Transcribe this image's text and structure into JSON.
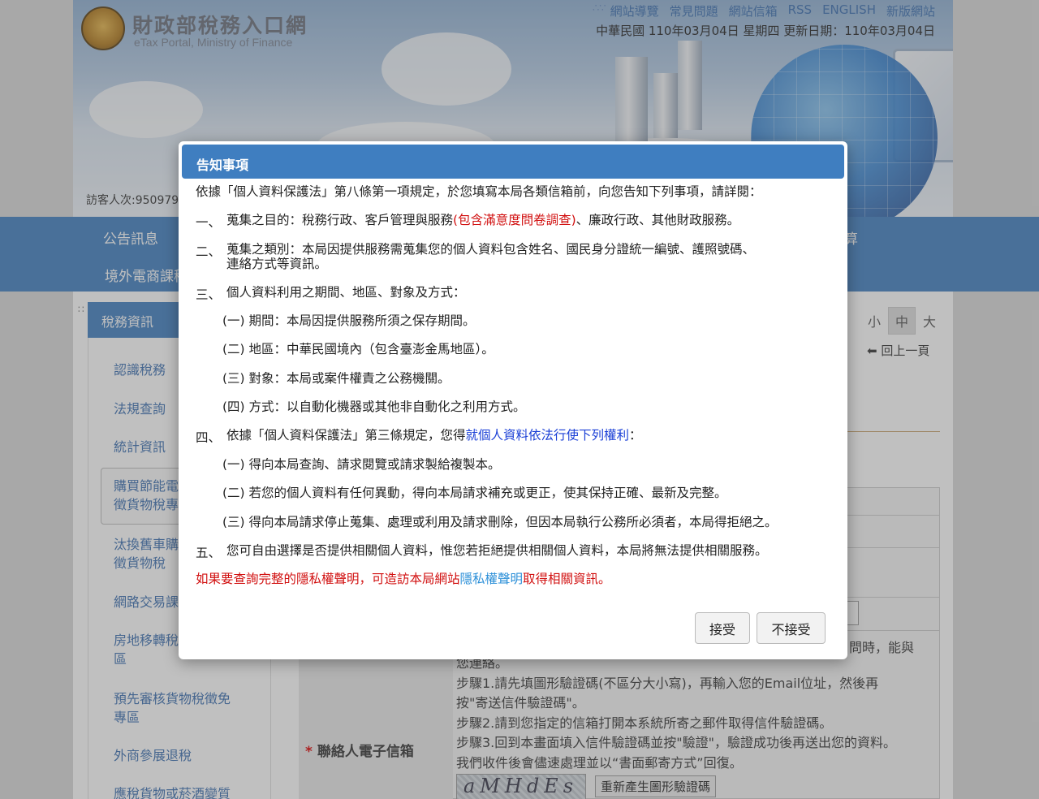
{
  "site": {
    "title": "財政部稅務入口網",
    "subtitle": "eTax Portal, Ministry of Finance",
    "top_links": [
      "網站導覽",
      "常見問題",
      "網站信箱",
      "RSS",
      "ENGLISH",
      "新版網站"
    ],
    "date_line": "中華民國 110年03月04日 星期四 更新日期：110年03月04日",
    "visitor": "訪客人次:950979"
  },
  "nav": {
    "item1": "公告訊息",
    "item2": "境外電商課稅",
    "item_right": "算"
  },
  "sidebar": {
    "heading": "稅務資訊",
    "items": [
      {
        "label": "認識稅務"
      },
      {
        "label": "法規查詢"
      },
      {
        "label": "統計資訊"
      },
      {
        "label_line1": "購買節能電",
        "label_line2": "徵貨物稅專"
      },
      {
        "label_line1": "汰換舊車購",
        "label_line2": "徵貨物稅"
      },
      {
        "label": "網路交易課"
      },
      {
        "label_line1": "房地移轉稅",
        "label_line2": "區"
      },
      {
        "label_line1": "預先審核貨物稅徵免",
        "label_line2": "專區"
      },
      {
        "label": "外商參展退稅"
      },
      {
        "label": "應稅貨物或菸酒變質"
      }
    ]
  },
  "toolbar": {
    "font_small": "小",
    "font_mid": "中",
    "font_large": "大",
    "back": "回上一頁"
  },
  "form": {
    "email_label": "聯絡人電子信箱",
    "required_mark": "*",
    "note_tail": "問時，能與",
    "note_line0": "您連絡。",
    "step1a": "步驟1.請先填圖形驗證碼(不區分大小寫)，再輸入您的Email位址，然後再",
    "step1b": "按\"寄送信件驗證碼\"。",
    "step2": "步驟2.請到您指定的信箱打開本系統所寄之郵件取得信件驗證碼。",
    "step3": "步驟3.回到本畫面填入信件驗證碼並按\"驗證\"，驗證成功後再送出您的資料。",
    "step4": "我們收件後會儘速處理並以“書面郵寄方式”回復。",
    "captcha_text": "aMHdEs",
    "regen_button": "重新產生圖形驗證碼"
  },
  "modal": {
    "title": "告知事項",
    "intro": "依據「個人資料保護法」第八條第一項規定，於您填寫本局各類信箱前，向您告知下列事項，請詳閱：",
    "s1_num": "一、",
    "s1_a": "蒐集之目的：稅務行政、客戶管理與服務",
    "s1_red": "(包含滿意度問卷調查)",
    "s1_b": "、廉政行政、其他財政服務。",
    "s2_num": "二、",
    "s2_a": "蒐集之類別：本局因提供服務需蒐集您的個人資料包含姓名、國民身分證統一編號、護照號碼、",
    "s2_b": "連絡方式等資訊。",
    "s3_num": "三、",
    "s3": "個人資料利用之期間、地區、對象及方式：",
    "s3_1": "(一) 期間：本局因提供服務所須之保存期間。",
    "s3_2": "(二) 地區：中華民國境內（包含臺澎金馬地區）。",
    "s3_3": "(三) 對象：本局或案件權責之公務機關。",
    "s3_4": "(四) 方式：以自動化機器或其他非自動化之利用方式。",
    "s4_num": "四、",
    "s4_a": "依據「個人資料保護法」第三條規定，您得",
    "s4_blue": "就個人資料依法行使下列權利",
    "s4_b": "：",
    "s4_1": "(一) 得向本局查詢、請求閱覽或請求製給複製本。",
    "s4_2": "(二) 若您的個人資料有任何異動，得向本局請求補充或更正，使其保持正確、最新及完整。",
    "s4_3": "(三) 得向本局請求停止蒐集、處理或利用及請求刪除，但因本局執行公務所必須者，本局得拒絕之。",
    "s5_num": "五、",
    "s5": "您可自由選擇是否提供相關個人資料，惟您若拒絕提供相關個人資料，本局將無法提供相關服務。",
    "footer_a": "如果要查詢完整的隱私權聲明，可造訪本局網站",
    "footer_link": "隱私權聲明",
    "footer_b": "取得相關資訊。",
    "accept": "接受",
    "decline": "不接受"
  }
}
